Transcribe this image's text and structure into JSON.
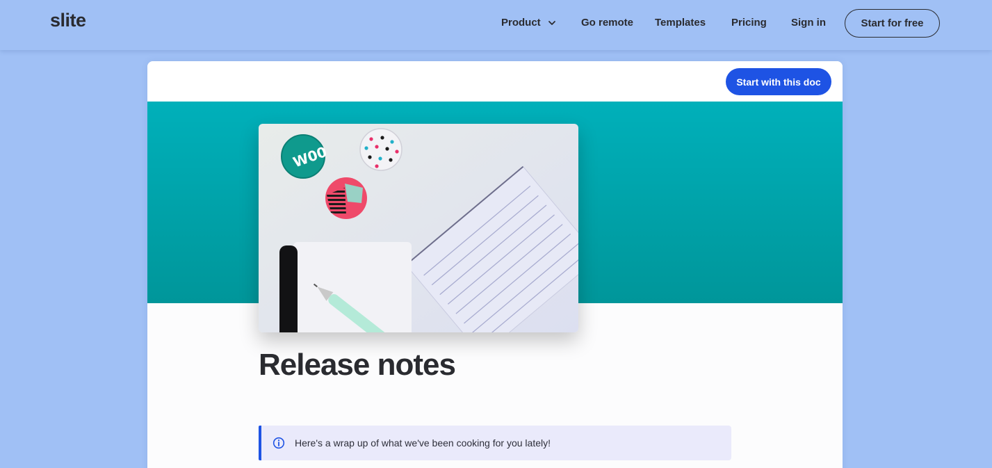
{
  "brand": {
    "logo": "slite"
  },
  "nav": {
    "items": [
      {
        "label": "Product",
        "has_dropdown": true
      },
      {
        "label": "Go remote"
      },
      {
        "label": "Templates"
      },
      {
        "label": "Pricing"
      },
      {
        "label": "Sign in"
      }
    ],
    "cta": "Start for free"
  },
  "doc": {
    "start_button": "Start with this doc",
    "title": "Release notes",
    "callout": {
      "icon": "info-icon",
      "text": "Here's a wrap up of what we've been cooking for you lately!"
    }
  },
  "colors": {
    "page_bg": "#a0c0f5",
    "accent": "#1e53e4",
    "banner_top": "#00b0ba",
    "banner_bottom": "#00969a"
  }
}
